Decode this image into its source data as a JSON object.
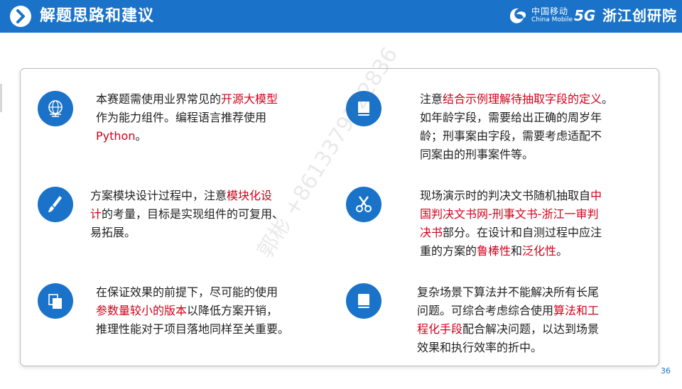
{
  "header": {
    "title": "解题思路和建议",
    "brand_cn": "中国移动",
    "brand_en": "China Mobile",
    "brand_5g": "5G",
    "brand_zj": "浙江创研院"
  },
  "watermark": "郭彬 +8613379722836",
  "page_number": "36",
  "items": [
    {
      "icon": "globe-icon",
      "lines": [
        [
          {
            "t": "本赛题需使用业界常见的"
          },
          {
            "t": "开源大模型",
            "r": true
          }
        ],
        [
          {
            "t": "作为能力组件。编程语言推荐使用"
          }
        ],
        [
          {
            "t": "Python",
            "r": true
          },
          {
            "t": "。"
          }
        ]
      ]
    },
    {
      "icon": "book-icon",
      "lines": [
        [
          {
            "t": "注意"
          },
          {
            "t": "结合示例理解待抽取字段的定义",
            "r": true
          },
          {
            "t": "。"
          }
        ],
        [
          {
            "t": "如年龄字段，需要给出正确的周岁年"
          }
        ],
        [
          {
            "t": "龄；刑事案由字段，需要考虑适配不"
          }
        ],
        [
          {
            "t": "同案由的刑事案件等。"
          }
        ]
      ]
    },
    {
      "icon": "brush-icon",
      "lines": [
        [
          {
            "t": "方案模块设计过程中，注意"
          },
          {
            "t": "模块化设",
            "r": true
          }
        ],
        [
          {
            "t": "计",
            "r": true
          },
          {
            "t": "的考量，目标是实现组件的可复用、"
          }
        ],
        [
          {
            "t": "易拓展。"
          }
        ]
      ]
    },
    {
      "icon": "scissors-icon",
      "lines": [
        [
          {
            "t": "现场演示时的判决文书随机抽取自"
          },
          {
            "t": "中",
            "r": true
          }
        ],
        [
          {
            "t": "国判决文书网-刑事文书-浙江一审判",
            "r": true
          }
        ],
        [
          {
            "t": "决书",
            "r": true
          },
          {
            "t": "部分。在设计和自测过程中应注"
          }
        ],
        [
          {
            "t": "重的方案的"
          },
          {
            "t": "鲁棒性",
            "r": true
          },
          {
            "t": "和"
          },
          {
            "t": "泛化性",
            "r": true
          },
          {
            "t": "。"
          }
        ]
      ]
    },
    {
      "icon": "copy-icon",
      "lines": [
        [
          {
            "t": "在保证效果的前提下，尽可能的使用"
          }
        ],
        [
          {
            "t": "参数量较小的版本",
            "r": true
          },
          {
            "t": "以降低方案开销，"
          }
        ],
        [
          {
            "t": "推理性能对于项目落地同样至关重要。"
          }
        ]
      ]
    },
    {
      "icon": "book-icon",
      "lines": [
        [
          {
            "t": "复杂场景下算法并不能解决所有长尾"
          }
        ],
        [
          {
            "t": "问题。可综合考虑综合使用"
          },
          {
            "t": "算法和工",
            "r": true
          }
        ],
        [
          {
            "t": "程化手段",
            "r": true
          },
          {
            "t": "配合解决问题，以达到场景"
          }
        ],
        [
          {
            "t": "效果和执行效率的折中。"
          }
        ]
      ]
    }
  ]
}
